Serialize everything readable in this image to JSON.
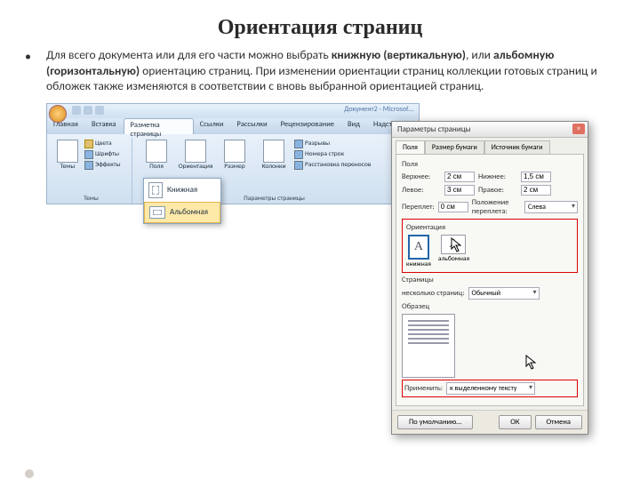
{
  "slide": {
    "title": "Ориентация страниц",
    "bullet": "•",
    "text_parts": {
      "p1": "Для всего документа или для его части можно выбрать ",
      "b1": "книжную (вертикальную)",
      "p2": ", или ",
      "b2": "альбомную (горизонтальную)",
      "p3": " ориентацию страниц. При изменении ориентации страниц коллекции готовых страниц и обложек также изменяются в соответствии с вновь выбранной ориентацией страниц."
    }
  },
  "ribbon": {
    "doc_title": "Документ2 - Microsof…",
    "tabs": [
      "Главная",
      "Вставка",
      "Разметка страницы",
      "Ссылки",
      "Рассылки",
      "Рецензирование",
      "Вид",
      "Надстройки"
    ],
    "active_tab_index": 2,
    "themes_group": {
      "label": "Темы",
      "btn": "Темы",
      "items": [
        "Цвета",
        "Шрифты",
        "Эффекты"
      ]
    },
    "page_setup_group": {
      "label": "Параметры страницы",
      "btns": [
        "Поля",
        "Ориентация",
        "Размер",
        "Колонки"
      ],
      "items": [
        "Разрывы",
        "Номера строк",
        "Расстановка переносов"
      ]
    },
    "dropdown": {
      "portrait": "Книжная",
      "landscape": "Альбомная"
    }
  },
  "dialog": {
    "title": "Параметры страницы",
    "tabs": [
      "Поля",
      "Размер бумаги",
      "Источник бумаги"
    ],
    "active_tab_index": 0,
    "fields_title": "Поля",
    "fields": {
      "top": {
        "label": "Верхнее:",
        "val": "2 см"
      },
      "bottom": {
        "label": "Нижнее:",
        "val": "1,5 см"
      },
      "left": {
        "label": "Левое:",
        "val": "3 см"
      },
      "right": {
        "label": "Правое:",
        "val": "2 см"
      },
      "gutter": {
        "label": "Переплет:",
        "val": "0 см"
      },
      "gutter_pos": {
        "label": "Положение переплета:",
        "val": "Слева"
      }
    },
    "orientation": {
      "title": "Ориентация",
      "portrait": "книжная",
      "landscape": "альбомная",
      "glyph": "A"
    },
    "pages": {
      "title": "Страницы",
      "label": "несколько страниц:",
      "value": "Обычный"
    },
    "preview_title": "Образец",
    "apply": {
      "label": "Применить:",
      "value": "к выделенному тексту"
    },
    "default_btn": "По умолчанию…",
    "ok": "ОК",
    "cancel": "Отмена"
  }
}
